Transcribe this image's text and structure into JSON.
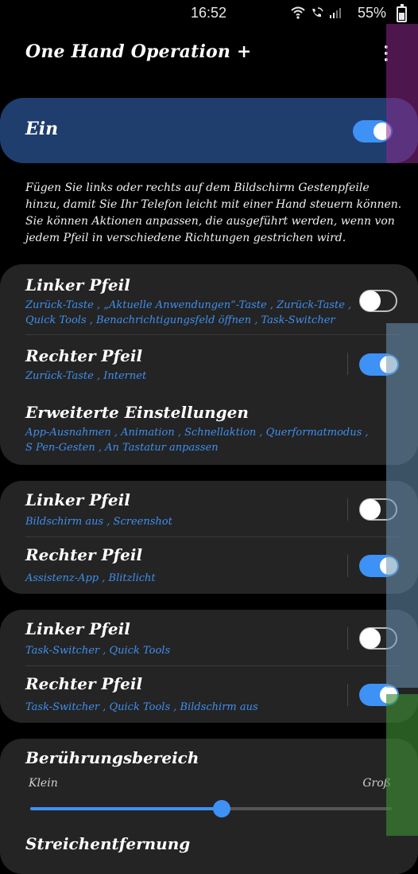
{
  "status": {
    "time": "16:52",
    "battery": "55%"
  },
  "app": {
    "title": "One Hand Operation +"
  },
  "master": {
    "label": "Ein",
    "on": true
  },
  "description": [
    "Fügen Sie links oder rechts auf dem Bildschirm Gestenpfeile hinzu, damit Sie Ihr Telefon leicht mit einer Hand steuern können.",
    "Sie können Aktionen anpassen, die ausgeführt werden, wenn von jedem Pfeil in verschiedene Richtungen gestrichen wird."
  ],
  "card1": {
    "left": {
      "title": "Linker Pfeil",
      "sub": "Zurück-Taste , „Aktuelle Anwendungen“-Taste , Zurück-Taste , Quick Tools , Benachrichtigungsfeld öffnen , Task-Switcher",
      "on": false
    },
    "right": {
      "title": "Rechter Pfeil",
      "sub": "Zurück-Taste , Internet",
      "on": true
    },
    "advanced": {
      "title": "Erweiterte Einstellungen",
      "sub": "App-Ausnahmen , Animation , Schnellaktion , Querformatmodus , S Pen-Gesten , An Tastatur anpassen"
    }
  },
  "card2": {
    "left": {
      "title": "Linker Pfeil",
      "sub": "Bildschirm aus , Screenshot",
      "on": false
    },
    "right": {
      "title": "Rechter Pfeil",
      "sub": "Assistenz-App , Blitzlicht",
      "on": true
    }
  },
  "card3": {
    "left": {
      "title": "Linker Pfeil",
      "sub": "Task-Switcher , Quick Tools",
      "on": false
    },
    "right": {
      "title": "Rechter Pfeil",
      "sub": "Task-Switcher , Quick Tools , Bildschirm aus",
      "on": true
    }
  },
  "touch_area": {
    "title": "Berührungsbereich",
    "min_label": "Klein",
    "max_label": "Groß",
    "value": 0.53
  },
  "swipe": {
    "title": "Streichentfernung"
  },
  "colors": {
    "accent": "#3e91f5",
    "master_bg": "#1f3e6e",
    "card_bg": "#242424",
    "subtext": "#3f8ff0"
  }
}
